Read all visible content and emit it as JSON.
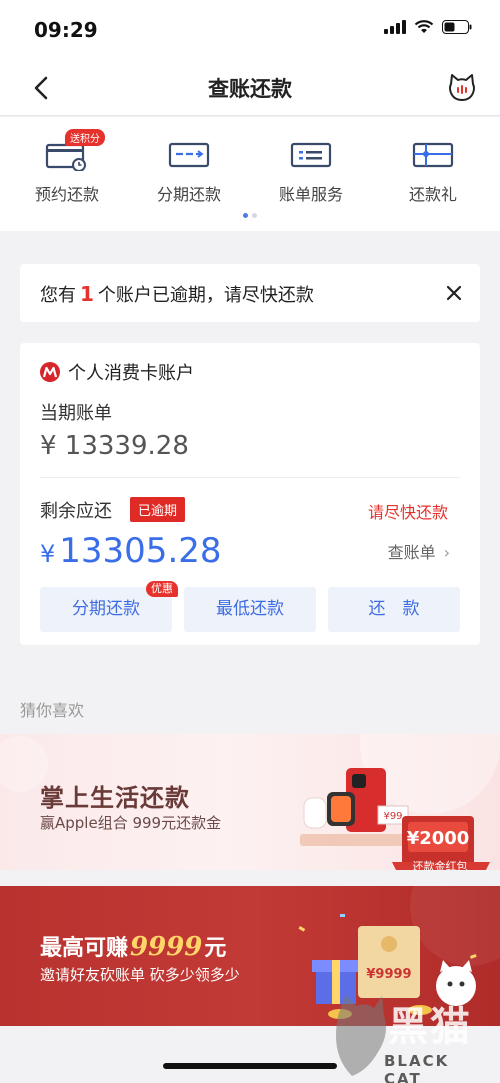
{
  "status_bar": {
    "time": "09:29"
  },
  "nav": {
    "title": "查账还款"
  },
  "quick_actions": [
    {
      "label": "预约还款",
      "tag": "送积分",
      "icon": "calendar-clock-icon"
    },
    {
      "label": "分期还款",
      "icon": "card-installment-icon"
    },
    {
      "label": "账单服务",
      "icon": "bill-list-icon"
    },
    {
      "label": "还款礼",
      "icon": "gift-card-icon"
    }
  ],
  "notice": {
    "prefix": "您有",
    "count": "1",
    "suffix": "个账户已逾期，请尽快还款"
  },
  "account": {
    "name": "个人消费卡账户",
    "current_bill_label": "当期账单",
    "current_bill_amount": "¥ 13339.28",
    "remaining_label": "剩余应还",
    "overdue_badge": "已逾期",
    "hurry_text": "请尽快还款",
    "remaining_currency": "¥",
    "remaining_amount": "13305.28",
    "bill_link": "查账单",
    "buttons": {
      "installment": "分期还款",
      "installment_tag": "优惠",
      "minimum": "最低还款",
      "repay": "还　款"
    }
  },
  "guess_label": "猜你喜欢",
  "banner1": {
    "title": "掌上生活还款",
    "subtitle": "赢Apple组合 999元还款金",
    "voucher": "¥2000",
    "red_packet": "还款金红包",
    "price_tag": "¥99"
  },
  "banner2": {
    "title_prefix": "最高可赚",
    "title_amount": "9999",
    "title_suffix": "元",
    "subtitle": "邀请好友砍账单 砍多少领多少",
    "envelope_amount": "¥9999"
  },
  "watermark": {
    "text": "黑猫",
    "sub": "BLACK CAT"
  },
  "colors": {
    "accent": "#3a6ee8",
    "alert": "#e6322d",
    "banner_red": "#b8322f"
  }
}
